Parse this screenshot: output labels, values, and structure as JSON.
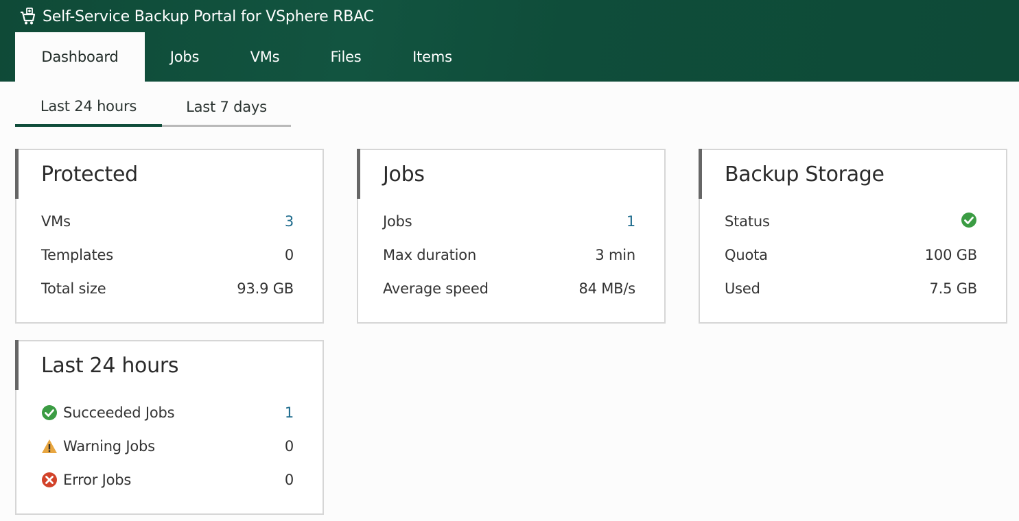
{
  "header": {
    "title": "Self-Service Backup Portal for VSphere RBAC",
    "icon": "cart-icon",
    "brand_color": "#0f4d3a"
  },
  "nav": {
    "tabs": [
      {
        "label": "Dashboard",
        "active": true
      },
      {
        "label": "Jobs",
        "active": false
      },
      {
        "label": "VMs",
        "active": false
      },
      {
        "label": "Files",
        "active": false
      },
      {
        "label": "Items",
        "active": false
      }
    ]
  },
  "period_tabs": [
    {
      "label": "Last 24 hours",
      "active": true
    },
    {
      "label": "Last 7 days",
      "active": false
    }
  ],
  "protected": {
    "title": "Protected",
    "rows": [
      {
        "label": "VMs",
        "value": "3"
      },
      {
        "label": "Templates",
        "value": "0"
      },
      {
        "label": "Total size",
        "value": "93.9 GB"
      }
    ]
  },
  "jobs": {
    "title": "Jobs",
    "rows": [
      {
        "label": "Jobs",
        "value": "1"
      },
      {
        "label": "Max duration",
        "value": "3 min"
      },
      {
        "label": "Average speed",
        "value": "84 MB/s"
      }
    ]
  },
  "storage": {
    "title": "Backup Storage",
    "rows": [
      {
        "label": "Status",
        "value_icon": "ok-check-icon"
      },
      {
        "label": "Quota",
        "value": "100 GB"
      },
      {
        "label": "Used",
        "value": "7.5 GB"
      }
    ]
  },
  "last24": {
    "title": "Last 24 hours",
    "rows": [
      {
        "label": "Succeeded Jobs",
        "value": "1",
        "icon": "success-check-icon"
      },
      {
        "label": "Warning Jobs",
        "value": "0",
        "icon": "warning-triangle-icon"
      },
      {
        "label": "Error Jobs",
        "value": "0",
        "icon": "error-x-icon"
      }
    ]
  },
  "colors": {
    "success": "#3b9c43",
    "warning": "#e8a640",
    "error": "#d2432a",
    "link": "#1c6a8c"
  }
}
